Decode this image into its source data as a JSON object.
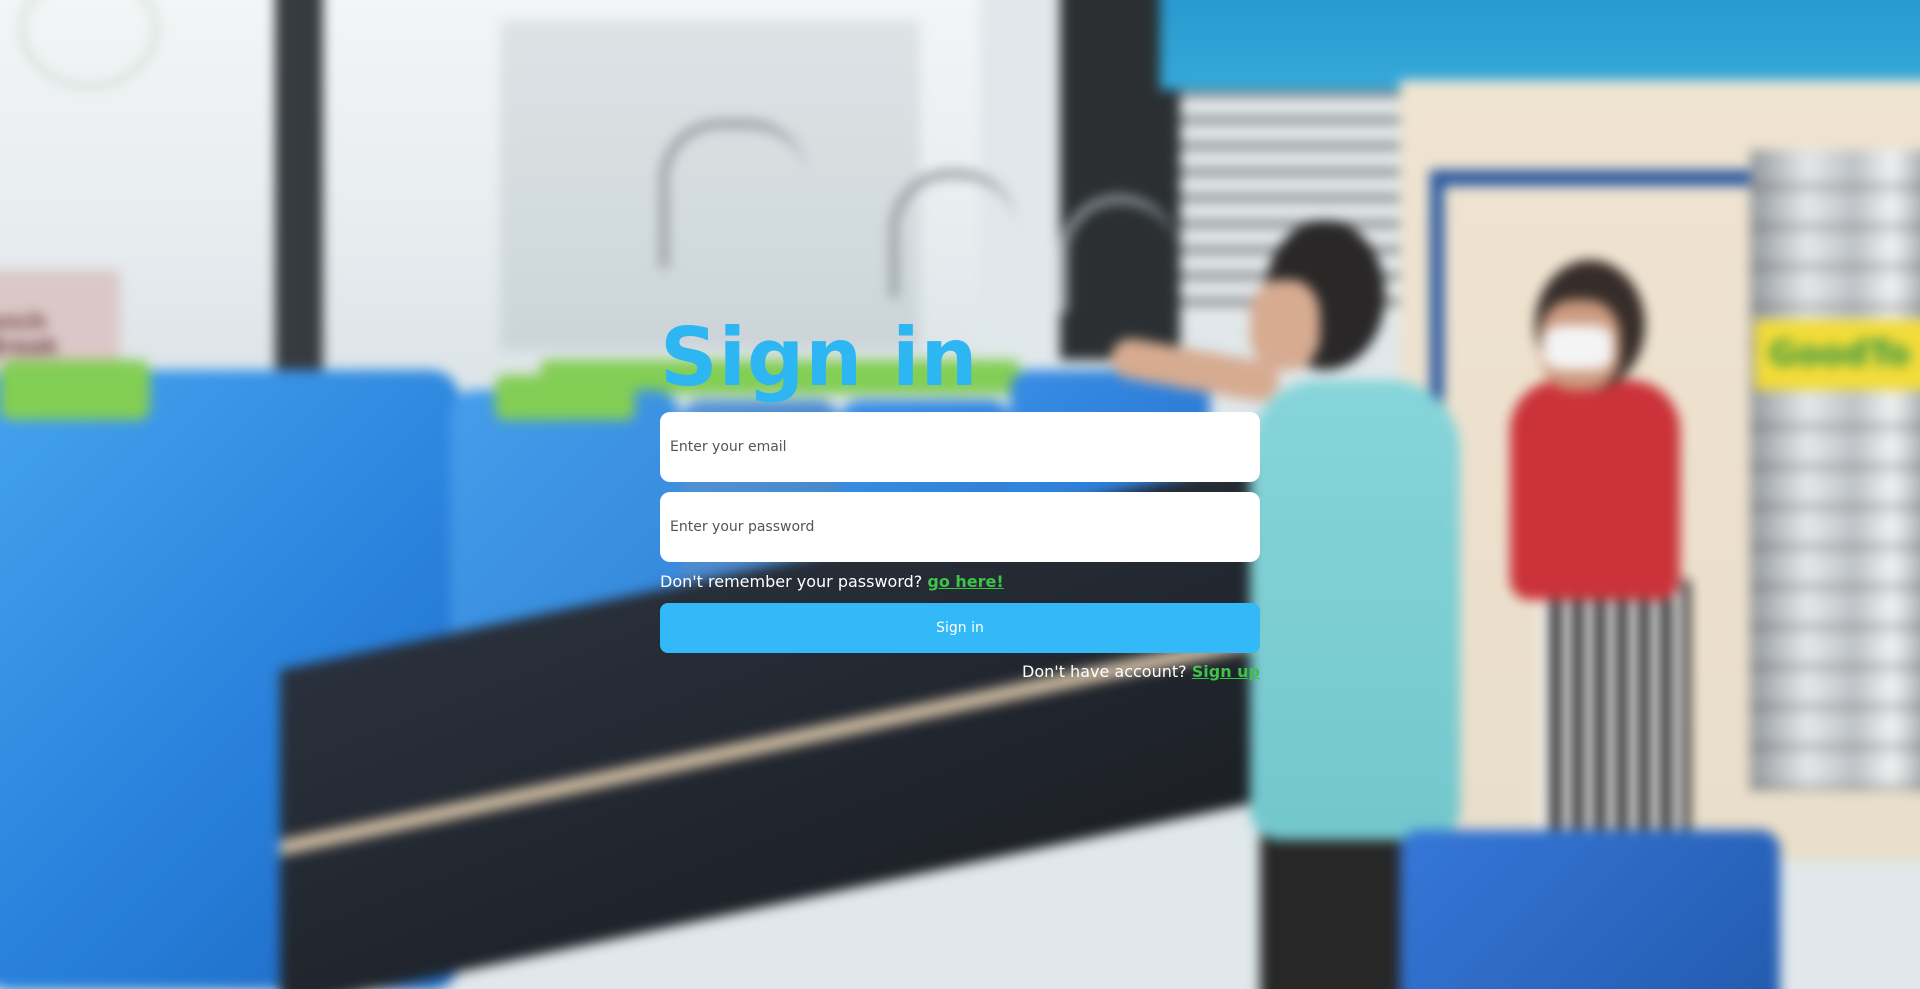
{
  "signin": {
    "title": "Sign in",
    "email_placeholder": "Enter your email",
    "password_placeholder": "Enter your password",
    "forgot_text": "Don't remember your password?",
    "forgot_link": "go here!",
    "button_label": "Sign in",
    "signup_text": "Don't have account?",
    "signup_link": "Sign up"
  },
  "background": {
    "sign_text": "unch Break",
    "tank_label": "GoodTo"
  },
  "colors": {
    "title": "#2eb6f3",
    "button": "#33b9f8",
    "link": "#3ec24a",
    "field_bg": "#ffffff"
  }
}
